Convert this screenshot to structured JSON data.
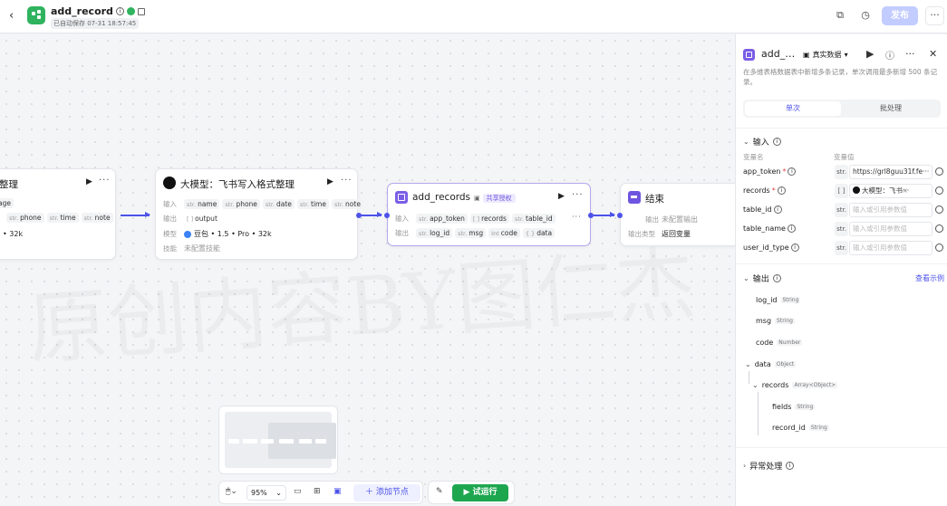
{
  "header": {
    "title": "add_record",
    "autosave": "已自动保存 07-31 18:57:45",
    "publish_label": "发布",
    "more_label": "···"
  },
  "canvas": {
    "watermark": "原创内容BY图仁杰",
    "node_prev": {
      "title": "整理",
      "row1_tag": "age",
      "row2": [
        {
          "type": "str.",
          "name": "phone"
        },
        {
          "type": "str.",
          "name": "time"
        },
        {
          "type": "str.",
          "name": "note"
        }
      ],
      "row3": "• 32k"
    },
    "node_llm": {
      "title": "大模型：飞书写入格式整理",
      "input_label": "输入",
      "inputs": [
        {
          "type": "str.",
          "name": "name"
        },
        {
          "type": "str.",
          "name": "phone"
        },
        {
          "type": "str.",
          "name": "date"
        },
        {
          "type": "str.",
          "name": "time"
        },
        {
          "type": "str.",
          "name": "note"
        }
      ],
      "output_label": "输出",
      "output": {
        "type": "[ ]",
        "name": "output"
      },
      "model_label": "模型",
      "model_value": "豆包 • 1.5 • Pro • 32k",
      "skill_label": "技能",
      "skill_value": "未配置技能"
    },
    "node_add": {
      "title": "add_records",
      "share_label": "共享授权",
      "input_label": "输入",
      "inputs": [
        {
          "type": "str.",
          "name": "app_token"
        },
        {
          "type": "[ ]",
          "name": "records"
        },
        {
          "type": "str.",
          "name": "table_id"
        }
      ],
      "output_label": "输出",
      "outputs": [
        {
          "type": "str.",
          "name": "log_id"
        },
        {
          "type": "str.",
          "name": "msg"
        },
        {
          "type": "Int",
          "name": "code"
        },
        {
          "type": "{ }",
          "name": "data"
        }
      ]
    },
    "node_end": {
      "title": "结束",
      "output_label": "输出",
      "output_value": "未配置输出",
      "type_label": "输出类型",
      "type_value": "返回变量"
    },
    "toolbar": {
      "zoom": "95%",
      "add_node": "添加节点",
      "run": "试运行"
    }
  },
  "panel": {
    "title": "add_…",
    "real_data": "真实数据",
    "description": "在多维表格数据表中新增多条记录，单次调用最多新增 500 条记录。",
    "tabs": [
      "单次",
      "批处理"
    ],
    "input_section": "输入",
    "col_name": "变量名",
    "col_value": "变量值",
    "inputs": [
      {
        "name": "app_token",
        "required": "*",
        "type": "str.",
        "value": "https://grl8guu31f.fe···"
      },
      {
        "name": "records",
        "required": "*",
        "type": "[ ]",
        "value": "大模型：飞书···"
      },
      {
        "name": "table_id",
        "required": "",
        "type": "str.",
        "value": "输入或引用参数值"
      },
      {
        "name": "table_name",
        "required": "",
        "type": "str.",
        "value": "输入或引用参数值"
      },
      {
        "name": "user_id_type",
        "required": "",
        "type": "str.",
        "value": "输入或引用参数值"
      }
    ],
    "output_section": "输出",
    "view_sample": "查看示例",
    "outputs": [
      {
        "name": "log_id",
        "type": "String"
      },
      {
        "name": "msg",
        "type": "String"
      },
      {
        "name": "code",
        "type": "Number"
      },
      {
        "name": "data",
        "type": "Object"
      },
      {
        "name": "records",
        "type": "Array<Object>"
      },
      {
        "name": "fields",
        "type": "String"
      },
      {
        "name": "record_id",
        "type": "String"
      }
    ],
    "exception_section": "异常处理"
  }
}
